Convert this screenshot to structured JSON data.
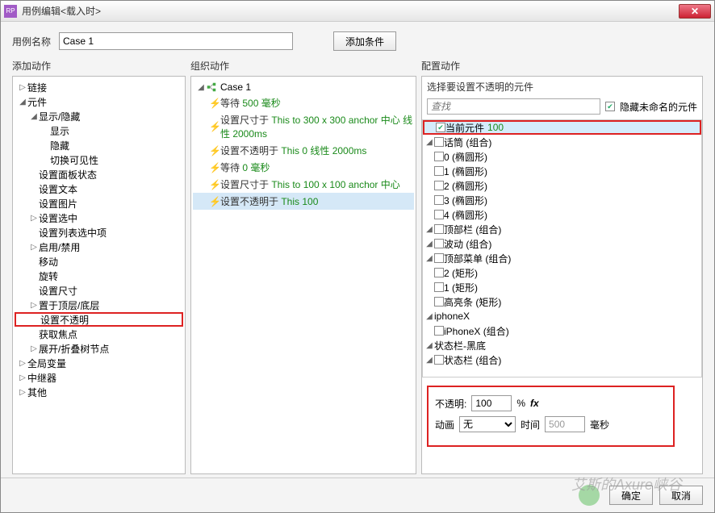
{
  "window": {
    "title": "用例编辑<载入时>"
  },
  "toprow": {
    "label": "用例名称",
    "value": "Case 1",
    "add_cond": "添加条件"
  },
  "cols": {
    "addaction": "添加动作",
    "organize": "组织动作",
    "configure": "配置动作"
  },
  "action_tree": [
    {
      "lvl": 0,
      "exp": "▷",
      "label": "链接"
    },
    {
      "lvl": 0,
      "exp": "◢",
      "label": "元件"
    },
    {
      "lvl": 1,
      "exp": "◢",
      "label": "显示/隐藏"
    },
    {
      "lvl": 2,
      "exp": "",
      "label": "显示"
    },
    {
      "lvl": 2,
      "exp": "",
      "label": "隐藏"
    },
    {
      "lvl": 2,
      "exp": "",
      "label": "切换可见性"
    },
    {
      "lvl": 1,
      "exp": "",
      "label": "设置面板状态"
    },
    {
      "lvl": 1,
      "exp": "",
      "label": "设置文本"
    },
    {
      "lvl": 1,
      "exp": "",
      "label": "设置图片"
    },
    {
      "lvl": 1,
      "exp": "▷",
      "label": "设置选中"
    },
    {
      "lvl": 1,
      "exp": "",
      "label": "设置列表选中项"
    },
    {
      "lvl": 1,
      "exp": "▷",
      "label": "启用/禁用"
    },
    {
      "lvl": 1,
      "exp": "",
      "label": "移动"
    },
    {
      "lvl": 1,
      "exp": "",
      "label": "旋转"
    },
    {
      "lvl": 1,
      "exp": "",
      "label": "设置尺寸"
    },
    {
      "lvl": 1,
      "exp": "▷",
      "label": "置于顶层/底层"
    },
    {
      "lvl": 1,
      "exp": "",
      "label": "设置不透明",
      "red": true
    },
    {
      "lvl": 1,
      "exp": "",
      "label": "获取焦点"
    },
    {
      "lvl": 1,
      "exp": "▷",
      "label": "展开/折叠树节点"
    },
    {
      "lvl": 0,
      "exp": "▷",
      "label": "全局变量"
    },
    {
      "lvl": 0,
      "exp": "▷",
      "label": "中继器"
    },
    {
      "lvl": 0,
      "exp": "▷",
      "label": "其他"
    }
  ],
  "case": {
    "name": "Case 1",
    "actions": [
      {
        "pre": "等待 ",
        "g": "500 毫秒"
      },
      {
        "pre": "设置尺寸于 ",
        "g": "This to 300 x 300 anchor 中心 线性 2000ms"
      },
      {
        "pre": "设置不透明于 ",
        "g": "This 0 线性 2000ms"
      },
      {
        "pre": "等待 ",
        "g": "0 毫秒"
      },
      {
        "pre": "设置尺寸于 ",
        "g": "This to 100 x 100 anchor 中心"
      },
      {
        "pre": "设置不透明于 ",
        "g": "This 100",
        "sel": true
      }
    ]
  },
  "config": {
    "select_label": "选择要设置不透明的元件",
    "search_ph": "查找",
    "hide_unnamed": "隐藏未命名的元件",
    "widgets": [
      {
        "lvl": 1,
        "exp": "",
        "cb": true,
        "checked": true,
        "label": "当前元件",
        "suffix": "100",
        "hl": true,
        "red": true
      },
      {
        "lvl": 1,
        "exp": "◢",
        "cb": true,
        "label": "话筒 (组合)"
      },
      {
        "lvl": 2,
        "exp": "",
        "cb": true,
        "label": "0 (椭圆形)"
      },
      {
        "lvl": 2,
        "exp": "",
        "cb": true,
        "label": "1 (椭圆形)"
      },
      {
        "lvl": 2,
        "exp": "",
        "cb": true,
        "label": "2 (椭圆形)"
      },
      {
        "lvl": 2,
        "exp": "",
        "cb": true,
        "label": "3 (椭圆形)"
      },
      {
        "lvl": 2,
        "exp": "",
        "cb": true,
        "label": "4 (椭圆形)"
      },
      {
        "lvl": 1,
        "exp": "◢",
        "cb": true,
        "label": "顶部栏 (组合)"
      },
      {
        "lvl": 2,
        "exp": "◢",
        "cb": true,
        "label": "波动 (组合)"
      },
      {
        "lvl": 2,
        "exp": "◢",
        "cb": true,
        "label": "顶部菜单 (组合)"
      },
      {
        "lvl": 3,
        "exp": "",
        "cb": true,
        "label": "2 (矩形)"
      },
      {
        "lvl": 3,
        "exp": "",
        "cb": true,
        "label": "1 (矩形)"
      },
      {
        "lvl": 3,
        "exp": "",
        "cb": true,
        "label": "高亮条 (矩形)"
      },
      {
        "lvl": 1,
        "exp": "◢",
        "cb": false,
        "label": "iphoneX"
      },
      {
        "lvl": 2,
        "exp": "",
        "cb": true,
        "label": "iPhoneX (组合)"
      },
      {
        "lvl": 1,
        "exp": "◢",
        "cb": false,
        "label": "状态栏-黑底"
      },
      {
        "lvl": 2,
        "exp": "◢",
        "cb": true,
        "label": "状态栏 (组合)"
      }
    ],
    "opacity": {
      "label": "不透明:",
      "value": "100",
      "pct": "%",
      "fx": "fx"
    },
    "anim": {
      "label": "动画",
      "value": "无",
      "time_label": "时间",
      "time_value": "500",
      "unit": "毫秒"
    }
  },
  "footer": {
    "ok": "确定",
    "cancel": "取消"
  },
  "watermark": "艾斯的Axure峡谷"
}
